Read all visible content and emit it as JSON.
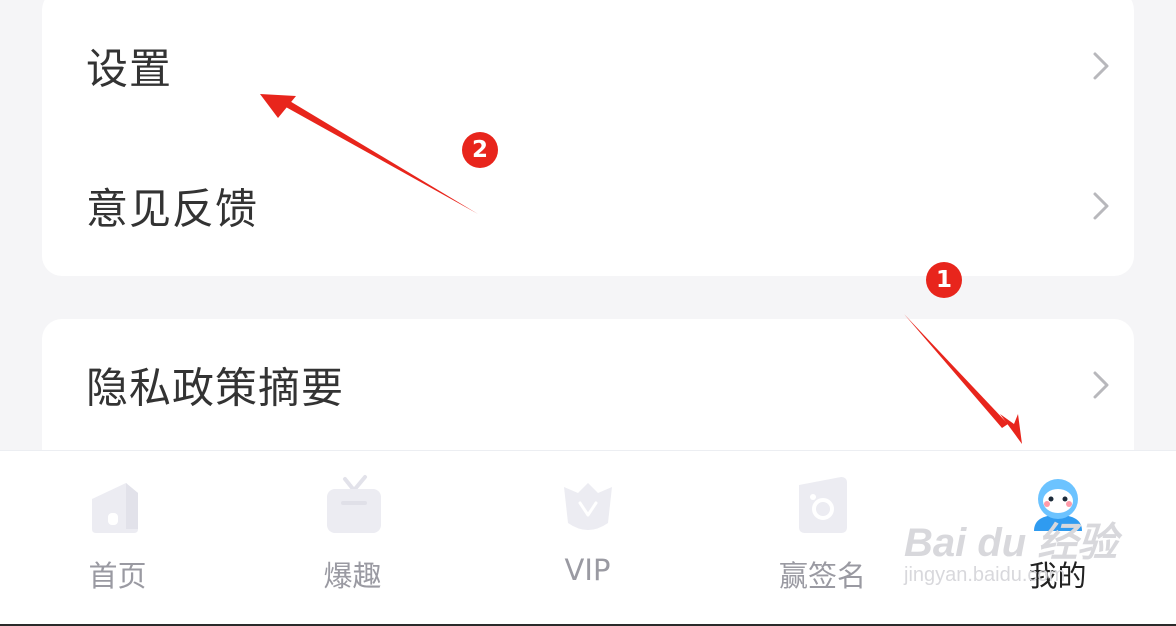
{
  "menu": {
    "group1": [
      {
        "label": "设置"
      },
      {
        "label": "意见反馈"
      }
    ],
    "group2": [
      {
        "label": "隐私政策摘要"
      }
    ]
  },
  "tabbar": {
    "tabs": [
      {
        "label": "首页",
        "icon": "home-icon"
      },
      {
        "label": "爆趣",
        "icon": "tv-icon"
      },
      {
        "label": "VIP",
        "icon": "vip-crown-icon"
      },
      {
        "label": "赢签名",
        "icon": "signature-icon"
      },
      {
        "label": "我的",
        "icon": "avatar-icon",
        "active": true
      }
    ]
  },
  "annotations": {
    "badge_1": "1",
    "badge_2": "2",
    "arrow_color": "#e8251c"
  },
  "watermark": {
    "main": "Bai du 经验",
    "sub": "jingyan.baidu.com"
  },
  "colors": {
    "background": "#f5f5f7",
    "card": "#ffffff",
    "text": "#333333",
    "tab_inactive": "#9a9aa2",
    "accent": "#2f9bf0"
  }
}
